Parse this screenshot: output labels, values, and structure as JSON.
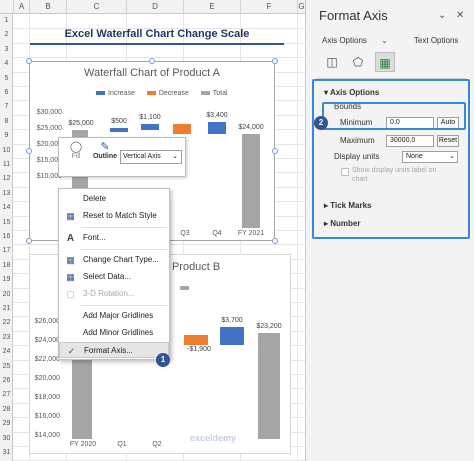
{
  "sheet": {
    "columns": [
      "A",
      "B",
      "C",
      "D",
      "E",
      "F",
      "G"
    ],
    "rows": [
      "1",
      "2",
      "3",
      "4",
      "5",
      "6",
      "7",
      "8",
      "9",
      "10",
      "11",
      "12",
      "13",
      "14",
      "15",
      "16",
      "17",
      "18",
      "19",
      "20",
      "21",
      "22",
      "23",
      "24",
      "25",
      "26",
      "27",
      "28",
      "29",
      "30",
      "31"
    ],
    "title": "Excel Waterfall Chart Change Scale"
  },
  "chart1": {
    "title": "Waterfall Chart of Product A",
    "legend": [
      {
        "label": "Increase",
        "color": "#4472c4"
      },
      {
        "label": "Decrease",
        "color": "#ed7d31"
      },
      {
        "label": "Total",
        "color": "#a5a5a5"
      }
    ],
    "y_ticks": [
      "$30,000",
      "$25,000",
      "$20,000",
      "$15,000",
      "$10,000"
    ],
    "x_labels": [
      "Q3",
      "Q4",
      "FY 2021"
    ],
    "data_labels": [
      "$25,000",
      "$500",
      "$1,100",
      "$3,400",
      "$24,000"
    ]
  },
  "chart2": {
    "title_visible": "of Product B",
    "y_ticks": [
      "$26,000",
      "$24,000",
      "$22,000",
      "$20,000",
      "$18,000",
      "$16,000",
      "$14,000"
    ],
    "x_labels": [
      "FY 2020",
      "Q1",
      "Q2"
    ],
    "data_labels": [
      "-$1,900",
      "$3,700",
      "$23,200"
    ]
  },
  "chart_data": [
    {
      "type": "bar",
      "title": "Waterfall Chart of Product A",
      "series": [
        {
          "name": "Increase",
          "values": [
            500,
            1100,
            3400
          ]
        },
        {
          "name": "Decrease",
          "values": []
        },
        {
          "name": "Total",
          "values": [
            25000,
            24000
          ]
        }
      ],
      "y_ticks": [
        "$30,000",
        "$25,000",
        "$20,000",
        "$15,000",
        "$10,000"
      ]
    }
  ],
  "mini_toolbar": {
    "fill_label": "Fill",
    "outline_label": "Outline",
    "selection_value": "Vertical Axis"
  },
  "context_menu": {
    "items": [
      {
        "label": "Delete",
        "icon": "delete-icon"
      },
      {
        "label": "Reset to Match Style",
        "icon": "reset-style-icon"
      },
      {
        "label": "Font...",
        "icon": "font-icon"
      },
      {
        "label": "Change Chart Type...",
        "icon": "change-chart-type-icon"
      },
      {
        "label": "Select Data...",
        "icon": "select-data-icon"
      },
      {
        "label": "3-D Rotation...",
        "icon": "rotation-icon"
      },
      {
        "label": "Add Major Gridlines",
        "icon": ""
      },
      {
        "label": "Add Minor Gridlines",
        "icon": ""
      },
      {
        "label": "Format Axis...",
        "icon": "format-axis-icon"
      }
    ]
  },
  "badges": {
    "step1": "1",
    "step2": "2"
  },
  "pane": {
    "title": "Format Axis",
    "tab_axis_options": "Axis Options",
    "tab_text_options": "Text Options",
    "section_axis_options": "Axis Options",
    "bounds_label": "Bounds",
    "minimum_label": "Minimum",
    "minimum_value": "0.0",
    "minimum_btn": "Auto",
    "maximum_label": "Maximum",
    "maximum_value": "30000.0",
    "maximum_btn": "Reset",
    "display_units_label": "Display units",
    "display_units_value": "None",
    "show_units_label": "Show display units label on chart",
    "tick_marks": "Tick Marks",
    "number": "Number"
  },
  "watermark": "exceldemy"
}
